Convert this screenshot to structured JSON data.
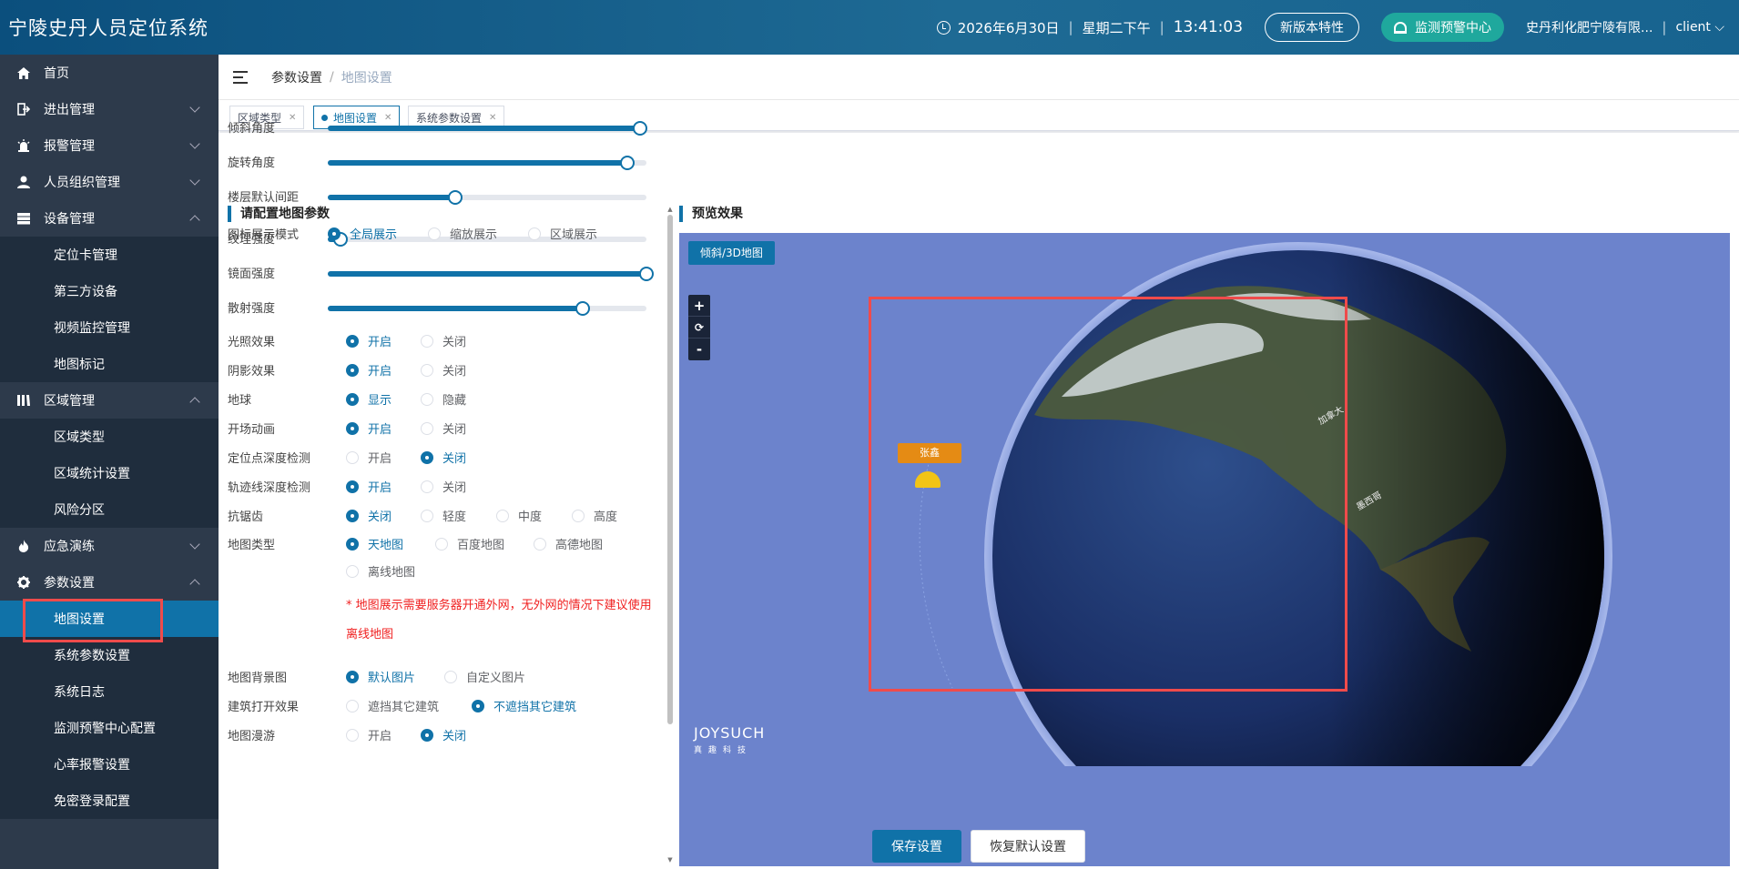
{
  "header": {
    "title": "宁陵史丹人员定位系统",
    "date": "2026年6月30日",
    "weekday": "星期二下午",
    "time": "13:41:03",
    "new_features_label": "新版本特性",
    "alarm_center_label": "监测预警中心",
    "company": "史丹利化肥宁陵有限...",
    "user": "client"
  },
  "sidebar": {
    "home": "首页",
    "access": "进出管理",
    "alarm": "报警管理",
    "personnel": "人员组织管理",
    "device": "设备管理",
    "device_sub": [
      "定位卡管理",
      "第三方设备",
      "视频监控管理",
      "地图标记"
    ],
    "area": "区域管理",
    "area_sub": [
      "区域类型",
      "区域统计设置",
      "风险分区"
    ],
    "drill": "应急演练",
    "params": "参数设置",
    "params_sub": [
      "地图设置",
      "系统参数设置",
      "系统日志",
      "监测预警中心配置",
      "心率报警设置",
      "免密登录配置"
    ]
  },
  "breadcrumb": {
    "parent": "参数设置",
    "current": "地图设置"
  },
  "tabs": [
    {
      "label": "区域类型"
    },
    {
      "label": "地图设置"
    },
    {
      "label": "系统参数设置"
    }
  ],
  "form": {
    "section_title": "请配置地图参数",
    "sliders": [
      {
        "label": "倾斜角度",
        "value": 0.98
      },
      {
        "label": "旋转角度",
        "value": 0.94
      },
      {
        "label": "楼层默认间距",
        "value": 0.4
      },
      {
        "label": "纹理强度",
        "value": 0.04
      },
      {
        "label": "镜面强度",
        "value": 1.0
      },
      {
        "label": "散射强度",
        "value": 0.8
      }
    ],
    "icon_mode": {
      "label": "图标展示模式",
      "options": [
        "全局展示",
        "缩放展示",
        "区域展示"
      ]
    },
    "lighting": {
      "label": "光照效果",
      "options": [
        "开启",
        "关闭"
      ]
    },
    "shadow": {
      "label": "阴影效果",
      "options": [
        "开启",
        "关闭"
      ]
    },
    "globe": {
      "label": "地球",
      "options": [
        "显示",
        "隐藏"
      ]
    },
    "intro_anim": {
      "label": "开场动画",
      "options": [
        "开启",
        "关闭"
      ]
    },
    "point_depth": {
      "label": "定位点深度检测",
      "options": [
        "开启",
        "关闭"
      ]
    },
    "track_depth": {
      "label": "轨迹线深度检测",
      "options": [
        "开启",
        "关闭"
      ]
    },
    "antialias": {
      "label": "抗锯齿",
      "options": [
        "关闭",
        "轻度",
        "中度",
        "高度"
      ]
    },
    "map_type": {
      "label": "地图类型",
      "options": [
        "天地图",
        "百度地图",
        "高德地图",
        "离线地图"
      ]
    },
    "map_warning": "* 地图展示需要服务器开通外网，无外网的情况下建议使用离线地图",
    "map_bg": {
      "label": "地图背景图",
      "options": [
        "默认图片",
        "自定义图片"
      ]
    },
    "building_open": {
      "label": "建筑打开效果",
      "options": [
        "遮挡其它建筑",
        "不遮挡其它建筑"
      ]
    },
    "map_roam": {
      "label": "地图漫游",
      "options": [
        "开启",
        "关闭"
      ]
    }
  },
  "preview": {
    "title": "预览效果",
    "mode_button": "倾斜/3D地图",
    "zoom_in": "+",
    "reset": "⟳",
    "zoom_out": "-",
    "marker_name": "张鑫",
    "label_canada": "加拿大",
    "label_mexico": "墨西哥",
    "logo_main": "JOYSUCH",
    "logo_sub": "真趣科技"
  },
  "actions": {
    "save": "保存设置",
    "reset": "恢复默认设置"
  },
  "colors": {
    "primary": "#1072a8",
    "sidebar": "#2d3a4b",
    "alarm": "#1fa89d",
    "warning": "#f01f1f"
  }
}
